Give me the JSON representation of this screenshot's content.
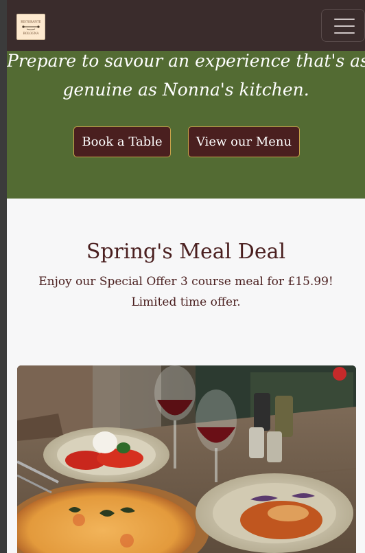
{
  "navbar": {
    "logo_alt": "Ristorante Bologna logo",
    "logo_line1": "RISTORANTE",
    "logo_line2": "BOLOGNA",
    "menu_icon": "hamburger-icon"
  },
  "hero": {
    "line1": "Prepare to savour an experience that's as",
    "line2": "genuine as Nonna's kitchen.",
    "book_label": "Book a Table",
    "menu_label": "View our Menu"
  },
  "offer": {
    "title": "Spring's Meal Deal",
    "desc_line1": "Enjoy our Special Offer 3 course meal for £15.99!",
    "desc_line2": "Limited time offer."
  },
  "image": {
    "alt": "Pizza, caprese salad, pasta and red wine on a wooden table"
  },
  "colors": {
    "navbar": "#3a2c2c",
    "hero": "#536b33",
    "button": "#4a1f1f",
    "button_border": "#c9a24a",
    "heading": "#4a1f1f",
    "page_bg": "#f7f7f8"
  }
}
